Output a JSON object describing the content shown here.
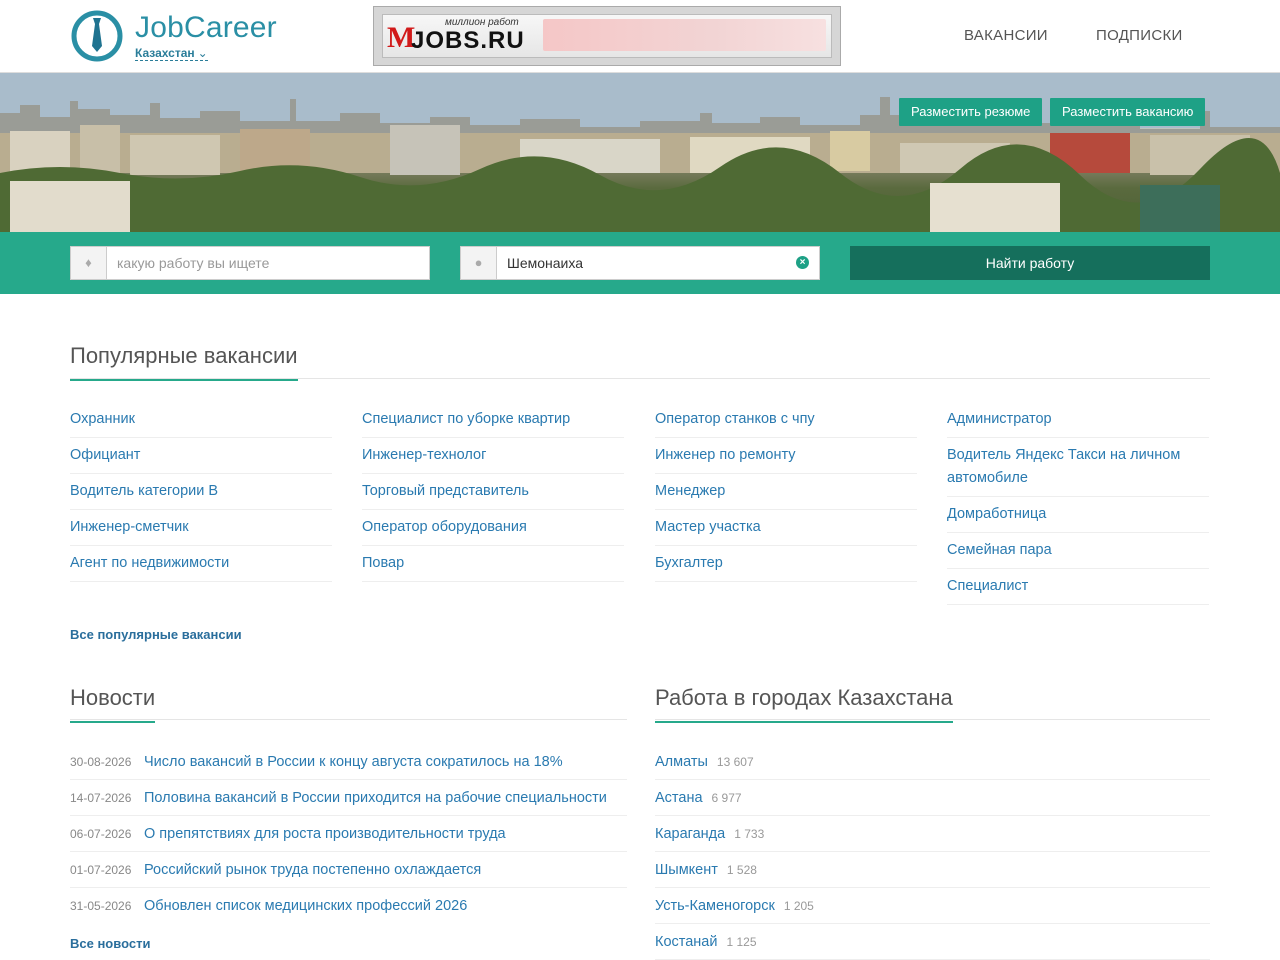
{
  "header": {
    "brand": "JobCareer",
    "region": "Казахстан",
    "banner": {
      "tagline": "миллион работ",
      "m": "M",
      "jobs": "JOBS.RU"
    },
    "nav": [
      "ВАКАНСИИ",
      "ПОДПИСКИ"
    ]
  },
  "hero": {
    "post_resume": "Разместить резюме",
    "post_vacancy": "Разместить вакансию"
  },
  "search": {
    "query_placeholder": "какую работу вы ищете",
    "location_value": "Шемонаиха",
    "button": "Найти работу"
  },
  "popular": {
    "title": "Популярные вакансии",
    "columns": [
      [
        "Охранник",
        "Официант",
        "Водитель категории В",
        "Инженер-сметчик",
        "Агент по недвижимости"
      ],
      [
        "Специалист по уборке квартир",
        "Инженер-технолог",
        "Торговый представитель",
        "Оператор оборудования",
        "Повар"
      ],
      [
        "Оператор станков с чпу",
        "Инженер по ремонту",
        "Менеджер",
        "Мастер участка",
        "Бухгалтер"
      ],
      [
        "Администратор",
        "Водитель Яндекс Такси на личном автомобиле",
        "Домработница",
        "Семейная пара",
        "Специалист"
      ]
    ],
    "all_link": "Все популярные вакансии"
  },
  "news": {
    "title": "Новости",
    "items": [
      {
        "date": "30-08-2026",
        "title": "Число вакансий в России к концу августа сократилось на 18%"
      },
      {
        "date": "14-07-2026",
        "title": "Половина вакансий в России приходится на рабочие специальности"
      },
      {
        "date": "06-07-2026",
        "title": "О препятствиях для роста производительности труда"
      },
      {
        "date": "01-07-2026",
        "title": "Российский рынок труда постепенно охлаждается"
      },
      {
        "date": "31-05-2026",
        "title": "Обновлен список медицинских профессий 2026"
      }
    ],
    "all_link": "Все новости"
  },
  "cities": {
    "title": "Работа в городах Казахстана",
    "items": [
      {
        "name": "Алматы",
        "count": "13 607"
      },
      {
        "name": "Астана",
        "count": "6 977"
      },
      {
        "name": "Караганда",
        "count": "1 733"
      },
      {
        "name": "Шымкент",
        "count": "1 528"
      },
      {
        "name": "Усть-Каменогорск",
        "count": "1 205"
      },
      {
        "name": "Костанай",
        "count": "1 125"
      }
    ]
  },
  "colors": {
    "accent": "#26a98b",
    "dark_accent": "#156f5c",
    "link": "#2a7ab0"
  },
  "icons": {
    "logo": "tie-logo-icon",
    "query": "tag-icon",
    "location": "map-pin-icon",
    "clear": "clear-icon",
    "region": "chevron-down-icon"
  }
}
